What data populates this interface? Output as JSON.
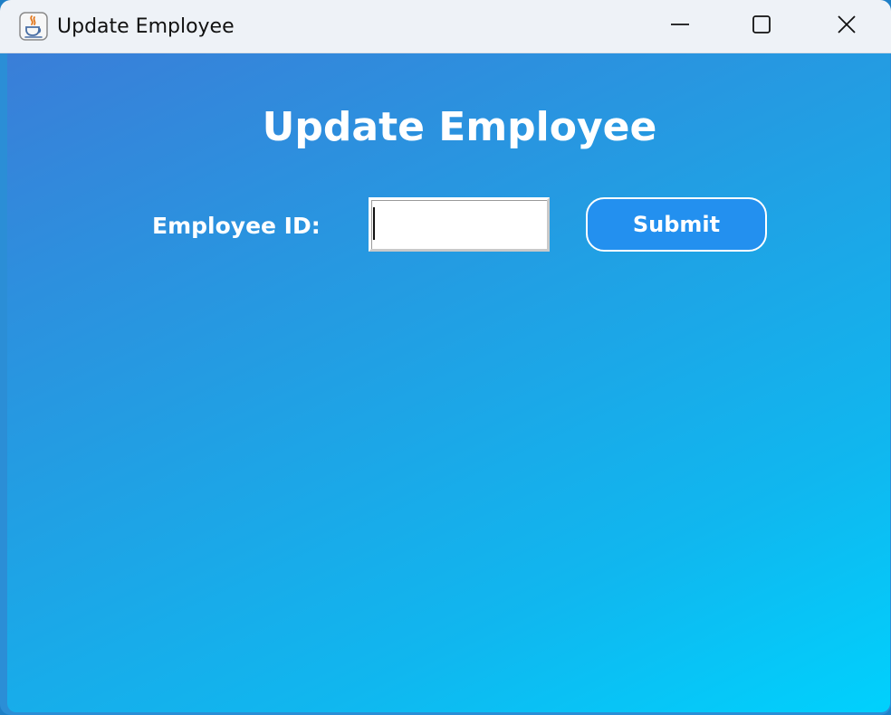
{
  "window": {
    "title": "Update Employee",
    "icon": "java-coffee-cup-icon",
    "controls": {
      "minimize": "minimize-icon",
      "maximize": "maximize-icon",
      "close": "close-icon"
    }
  },
  "form": {
    "heading": "Update Employee",
    "employee_id_label": "Employee ID:",
    "employee_id_value": "",
    "submit_label": "Submit"
  },
  "colors": {
    "gradient_start": "#3a7ed8",
    "gradient_end": "#00d1fd",
    "submit_button": "#2390ef",
    "text": "#ffffff"
  }
}
